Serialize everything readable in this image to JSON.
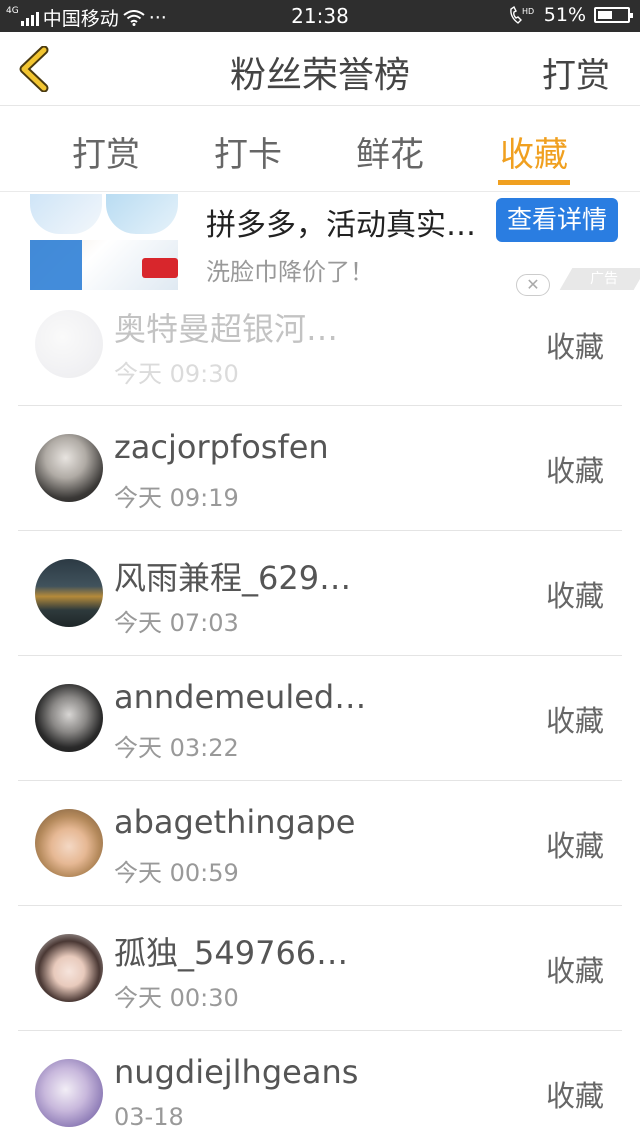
{
  "status_bar": {
    "network": "4G",
    "carrier": "中国移动",
    "more": "···",
    "time": "21:38",
    "hd": "HD",
    "battery_text": "51%",
    "battery_level": 0.51
  },
  "nav": {
    "title": "粉丝荣誉榜",
    "right_label": "打赏"
  },
  "tabs": [
    {
      "label": "打赏"
    },
    {
      "label": "打卡"
    },
    {
      "label": "鲜花"
    },
    {
      "label": "收藏"
    }
  ],
  "active_tab": "收藏",
  "ad": {
    "title": "拼多多，活动真实…",
    "subtitle": "洗脸巾降价了！",
    "button_label": "查看详情",
    "close": "✕",
    "badge": "广告"
  },
  "list": [
    {
      "name": "奥特曼超银河…",
      "time": "今天 09:30",
      "action": "收藏"
    },
    {
      "name": "zacjorpfosfen",
      "time": "今天 09:19",
      "action": "收藏"
    },
    {
      "name": "风雨兼程_629…",
      "time": "今天 07:03",
      "action": "收藏"
    },
    {
      "name": "anndemeuled…",
      "time": "今天 03:22",
      "action": "收藏"
    },
    {
      "name": "abagethingape",
      "time": "今天 00:59",
      "action": "收藏"
    },
    {
      "name": "孤独_549766…",
      "time": "今天 00:30",
      "action": "收藏"
    },
    {
      "name": "nugdiejlhgeans",
      "time": "03-18",
      "action": "收藏"
    }
  ],
  "colors": {
    "accent": "#f0a020",
    "ad_button": "#2a7de1",
    "status_bar": "#2e2e2e"
  }
}
